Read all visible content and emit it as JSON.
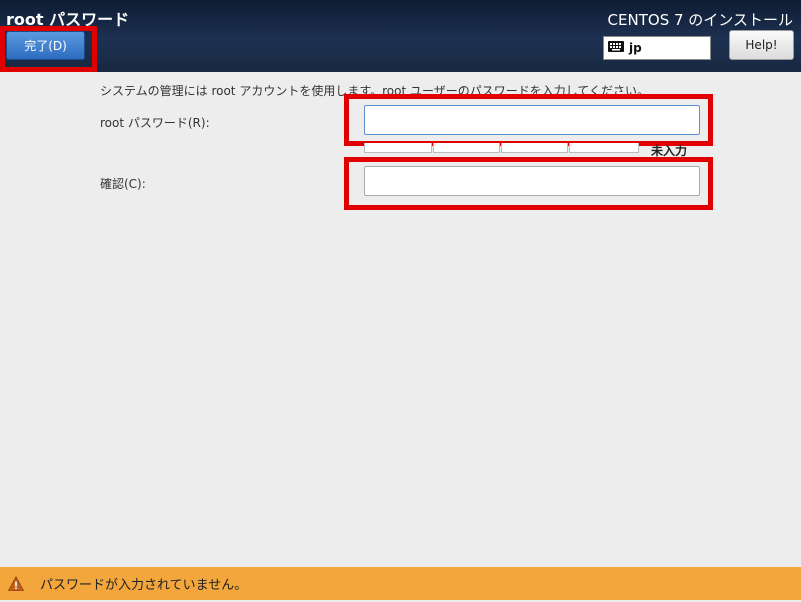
{
  "header": {
    "page_title": "root パスワード",
    "install_title": "CENTOS 7 のインストール",
    "done_label": "完了(D)",
    "keyboard_layout": "jp",
    "help_label": "Help!"
  },
  "form": {
    "description": "システムの管理には root アカウントを使用します。root ユーザーのパスワードを入力してください。",
    "password_label": "root パスワード(R):",
    "password_value": "",
    "strength_label": "未入力",
    "confirm_label": "確認(C):",
    "confirm_value": ""
  },
  "status": {
    "message": "パスワードが入力されていません。"
  },
  "colors": {
    "header_bg": "#1d3152",
    "status_bar": "#f3a63c",
    "highlight": "#e00000",
    "done_button": "#3b7fd4"
  },
  "icons": [
    "keyboard-icon",
    "warning-icon"
  ]
}
